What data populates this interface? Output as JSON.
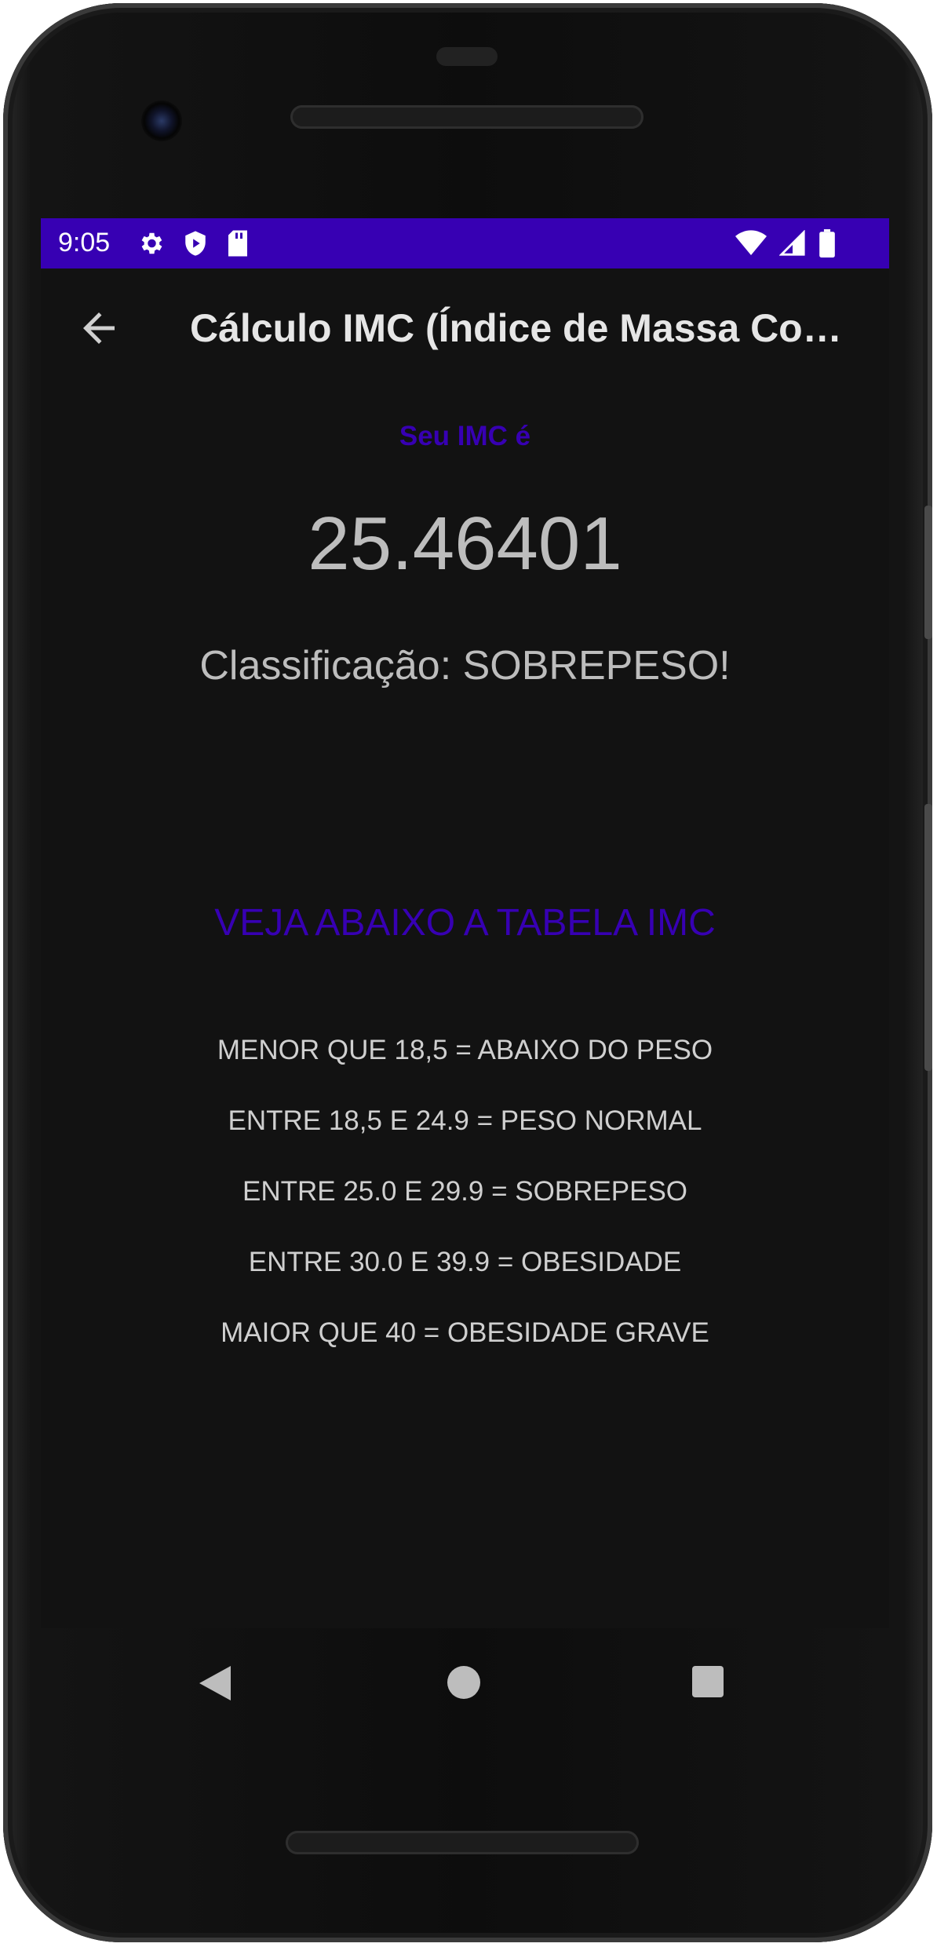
{
  "status_bar": {
    "time": "9:05",
    "left_icons": [
      "settings-icon",
      "shield-play-icon",
      "sd-card-icon"
    ],
    "right_icons": [
      "wifi-icon",
      "cell-signal-icon",
      "battery-icon"
    ],
    "background": "#3700b3"
  },
  "app_bar": {
    "title": "Cálculo IMC (Índice de Massa Co…",
    "back_icon": "arrow-back-icon"
  },
  "result": {
    "label": "Seu IMC é",
    "value": "25.46401",
    "classification": "Classificação: SOBREPESO!"
  },
  "table": {
    "heading": "VEJA ABAIXO A TABELA IMC",
    "rows": [
      "MENOR QUE 18,5 = ABAIXO DO PESO",
      "ENTRE 18,5 E 24.9 = PESO NORMAL",
      "ENTRE 25.0 E 29.9 = SOBREPESO",
      "ENTRE 30.0 E 39.9 = OBESIDADE",
      "MAIOR QUE 40 = OBESIDADE GRAVE"
    ]
  },
  "nav_bar": {
    "icons": [
      "nav-back-icon",
      "nav-home-icon",
      "nav-recents-icon"
    ]
  },
  "colors": {
    "accent": "#3700b3",
    "screen_background": "#121212",
    "text_primary": "#bdbdbd"
  }
}
